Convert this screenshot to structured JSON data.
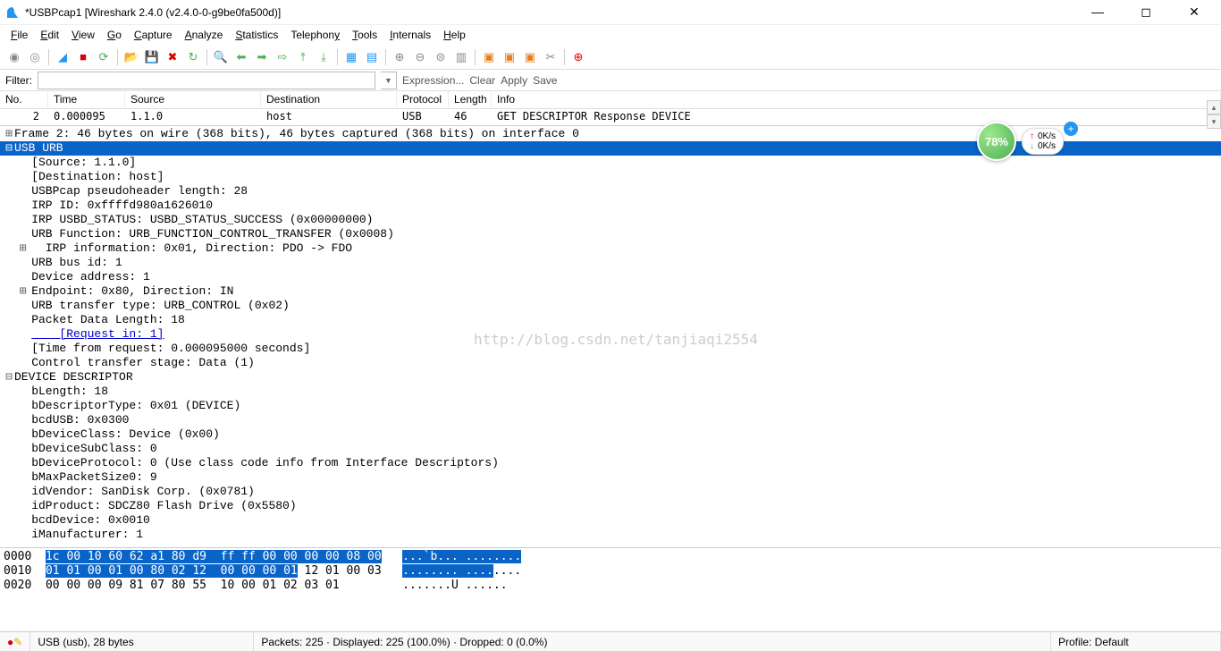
{
  "title": "*USBPcap1 [Wireshark 2.4.0 (v2.4.0-0-g9be0fa500d)]",
  "menu": [
    "File",
    "Edit",
    "View",
    "Go",
    "Capture",
    "Analyze",
    "Statistics",
    "Telephony",
    "Tools",
    "Internals",
    "Help"
  ],
  "filter": {
    "label": "Filter:",
    "value": "",
    "expr": "Expression...",
    "clear": "Clear",
    "apply": "Apply",
    "save": "Save"
  },
  "columns": [
    "No.",
    "Time",
    "Source",
    "Destination",
    "Protocol",
    "Length",
    "Info"
  ],
  "row": {
    "no": "2",
    "time": "0.000095",
    "src": "1.1.0",
    "dst": "host",
    "proto": "USB",
    "len": "46",
    "info": "GET DESCRIPTOR Response DEVICE"
  },
  "details": {
    "frame": "Frame 2: 46 bytes on wire (368 bits), 46 bytes captured (368 bits) on interface 0",
    "urb": "USB URB",
    "lines": [
      "    [Source: 1.1.0]",
      "    [Destination: host]",
      "    USBPcap pseudoheader length: 28",
      "    IRP ID: 0xffffd980a1626010",
      "    IRP USBD_STATUS: USBD_STATUS_SUCCESS (0x00000000)",
      "    URB Function: URB_FUNCTION_CONTROL_TRANSFER (0x0008)",
      "    IRP information: 0x01, Direction: PDO -> FDO",
      "    URB bus id: 1",
      "    Device address: 1",
      "    Endpoint: 0x80, Direction: IN",
      "    URB transfer type: URB_CONTROL (0x02)",
      "    Packet Data Length: 18",
      "    [Request in: 1]",
      "    [Time from request: 0.000095000 seconds]",
      "    Control transfer stage: Data (1)"
    ],
    "device": "DEVICE DESCRIPTOR",
    "dev_lines": [
      "    bLength: 18",
      "    bDescriptorType: 0x01 (DEVICE)",
      "    bcdUSB: 0x0300",
      "    bDeviceClass: Device (0x00)",
      "    bDeviceSubClass: 0",
      "    bDeviceProtocol: 0 (Use class code info from Interface Descriptors)",
      "    bMaxPacketSize0: 9",
      "    idVendor: SanDisk Corp. (0x0781)",
      "    idProduct: SDCZ80 Flash Drive (0x5580)",
      "    bcdDevice: 0x0010",
      "    iManufacturer: 1"
    ]
  },
  "hex": {
    "r0_off": "0000",
    "r0_a": "1c 00 10 60 62 a1 80 d9  ff ff 00 00 00 00 08 00",
    "r0_asc": "...`b... ........",
    "r1_off": "0010",
    "r1_a": "01 01 00 01 00 80 02 12  00 00 00 01",
    "r1_b": " 12 01 00 03",
    "r1_asc_a": "........ ....",
    "r1_asc_b": "....",
    "r2_off": "0020",
    "r2_a": "00 00 00 09 81 07 80 55  10 00 01 02 03 01",
    "r2_asc": ".......U ......"
  },
  "status": {
    "left": "USB (usb), 28 bytes",
    "mid": "Packets: 225 · Displayed: 225 (100.0%) · Dropped: 0 (0.0%)",
    "right": "Profile: Default"
  },
  "overlay": {
    "pct": "78%",
    "up": "0K/s",
    "dn": "0K/s"
  },
  "watermark": "http://blog.csdn.net/tanjiaqi2554"
}
